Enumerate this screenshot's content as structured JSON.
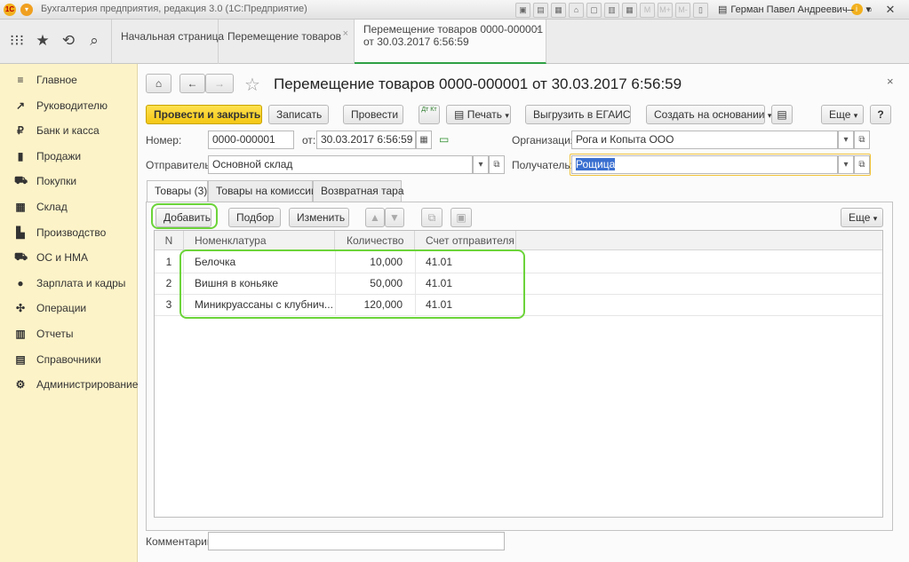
{
  "window": {
    "title": "Бухгалтерия предприятия, редакция 3.0  (1С:Предприятие)",
    "user": "Герман Павел Андреевич",
    "toolbar_tips": [
      "M",
      "M+",
      "M-"
    ]
  },
  "tabs": [
    {
      "label": "Начальная страница"
    },
    {
      "label": "Перемещение товаров"
    },
    {
      "label": "Перемещение товаров 0000-000001",
      "label2": "от 30.03.2017 6:56:59"
    }
  ],
  "sidebar": {
    "items": [
      {
        "label": "Главное",
        "icon": "≡"
      },
      {
        "label": "Руководителю",
        "icon": "↗"
      },
      {
        "label": "Банк и касса",
        "icon": "₽"
      },
      {
        "label": "Продажи",
        "icon": "▮"
      },
      {
        "label": "Покупки",
        "icon": "⛟"
      },
      {
        "label": "Склад",
        "icon": "▦"
      },
      {
        "label": "Производство",
        "icon": "▙"
      },
      {
        "label": "ОС и НМА",
        "icon": "⛟"
      },
      {
        "label": "Зарплата и кадры",
        "icon": "●"
      },
      {
        "label": "Операции",
        "icon": "✣"
      },
      {
        "label": "Отчеты",
        "icon": "▥"
      },
      {
        "label": "Справочники",
        "icon": "▤"
      },
      {
        "label": "Администрирование",
        "icon": "⚙"
      }
    ]
  },
  "form": {
    "title": "Перемещение товаров 0000-000001 от 30.03.2017 6:56:59",
    "buttons": {
      "post_close": "Провести и закрыть",
      "save": "Записать",
      "post": "Провести",
      "dtkt": "Дт Кт",
      "print": "Печать",
      "egais": "Выгрузить в ЕГАИС",
      "create_based": "Создать на основании",
      "more": "Еще",
      "help": "?"
    },
    "fields": {
      "number_label": "Номер:",
      "number_value": "0000-000001",
      "date_label": "от:",
      "date_value": "30.03.2017  6:56:59",
      "org_label": "Организация:",
      "org_value": "Рога и Копыта ООО",
      "sender_label": "Отправитель:",
      "sender_value": "Основной склад",
      "receiver_label": "Получатель:",
      "receiver_value": "Рощица",
      "comment_label": "Комментарий:",
      "comment_value": ""
    },
    "inner_tabs": [
      "Товары (3)",
      "Товары на комиссии",
      "Возвратная тара"
    ],
    "table_toolbar": {
      "add": "Добавить",
      "pick": "Подбор",
      "edit": "Изменить",
      "more": "Еще"
    },
    "table": {
      "columns": [
        "N",
        "Номенклатура",
        "Количество",
        "Счет отправителя"
      ],
      "rows": [
        {
          "n": "1",
          "name": "Белочка",
          "qty": "10,000",
          "account": "41.01"
        },
        {
          "n": "2",
          "name": "Вишня в коньяке",
          "qty": "50,000",
          "account": "41.01"
        },
        {
          "n": "3",
          "name": "Миникруассаны с клубнич...",
          "qty": "120,000",
          "account": "41.01"
        }
      ]
    }
  }
}
